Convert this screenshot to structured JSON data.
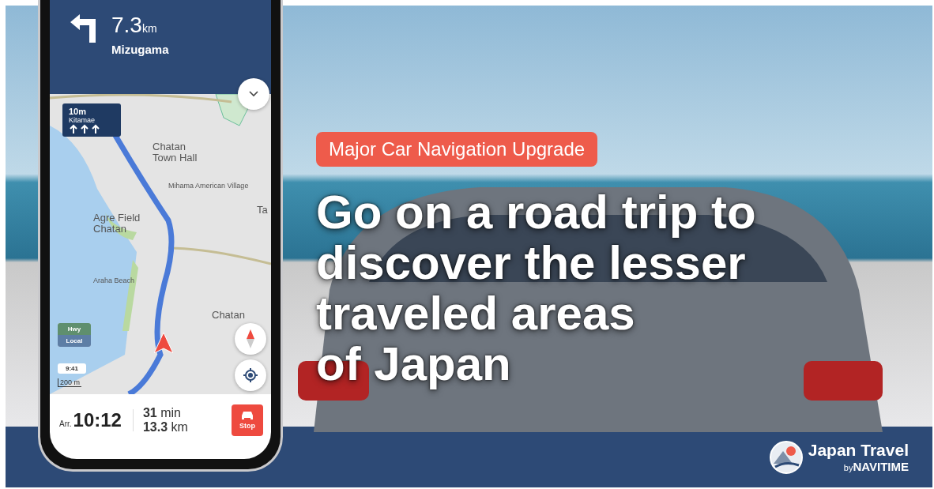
{
  "banner": {
    "badge": "Major Car Navigation Upgrade",
    "headline_lines": [
      "Go on a road trip to",
      "discover the lesser",
      "traveled areas",
      "of Japan"
    ],
    "logo": {
      "title": "Japan Travel",
      "byline": "by**NAVITIME**"
    }
  },
  "phone": {
    "guidance": {
      "distance": "7.3",
      "unit": "km",
      "street": "Mizugama"
    },
    "lane_guide": {
      "distance": "10m",
      "name": "Kitamae"
    },
    "map_labels": [
      {
        "text": "Chatan Town Hall",
        "kind": "poi"
      },
      {
        "text": "Mihama American Village",
        "kind": "small"
      },
      {
        "text": "Agre Field Chatan",
        "kind": "area"
      },
      {
        "text": "Araha Beach",
        "kind": "small"
      },
      {
        "text": "Chatan",
        "kind": "area"
      },
      {
        "text": "Ta",
        "kind": "area"
      }
    ],
    "road_toggle": {
      "top": "Hwy",
      "bottom": "Local"
    },
    "clock": "9:41",
    "scale": "200 m",
    "trip": {
      "arrival_label": "Arr.",
      "arrival": "10:12",
      "duration": "**31** min",
      "distance": "**13.3** km"
    },
    "stop_button": "Stop"
  }
}
